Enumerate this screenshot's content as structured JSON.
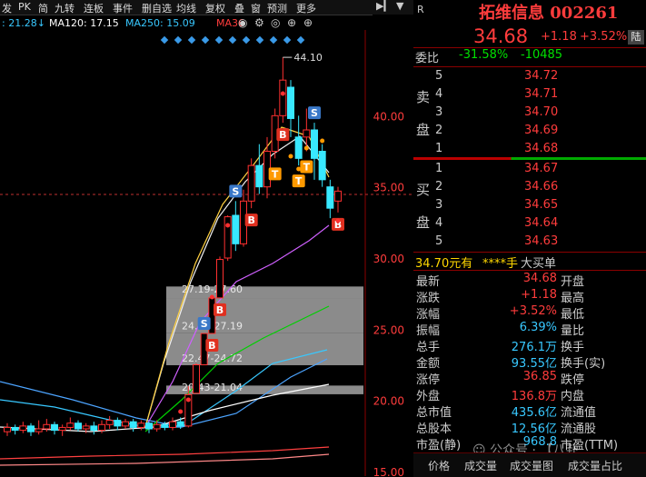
{
  "toolbar": {
    "items": [
      "发",
      "PK",
      "简",
      "九转",
      "连板",
      "事件",
      "删自选",
      "均线",
      "复权",
      "叠",
      "窗",
      "预测",
      "更多"
    ],
    "eye_icon": "eye-icon",
    "lock_icon": "lock-icon",
    "land_label": "陆"
  },
  "ma_legend": [
    {
      "text": ": 21.28↓",
      "color": "#38c8ff"
    },
    {
      "text": "MA120: 17.15",
      "color": "#ffffff"
    },
    {
      "text": "MA250: 15.09",
      "color": "#38c8ff"
    },
    {
      "text": "MA36",
      "color": "#ff3c3c"
    }
  ],
  "chart_data": {
    "type": "candlestick",
    "price_levels": [
      "40.00",
      "35.00",
      "30.00",
      "25.00",
      "20.00",
      "15.00"
    ],
    "ylim": [
      15,
      45
    ],
    "max_label": "44.10",
    "ranges": [
      "27.19-27.60",
      "24.72-27.19",
      "22.47-24.72",
      "20.43-21.04"
    ],
    "candles": [
      {
        "o": 17.8,
        "c": 18.1,
        "h": 18.4,
        "l": 17.5
      },
      {
        "o": 18.1,
        "c": 17.9,
        "h": 18.3,
        "l": 17.6
      },
      {
        "o": 17.9,
        "c": 18.2,
        "h": 18.5,
        "l": 17.7
      },
      {
        "o": 18.2,
        "c": 17.8,
        "h": 18.4,
        "l": 17.5
      },
      {
        "o": 17.8,
        "c": 18.0,
        "h": 18.6,
        "l": 17.6
      },
      {
        "o": 18.0,
        "c": 18.3,
        "h": 18.7,
        "l": 17.8
      },
      {
        "o": 18.3,
        "c": 17.9,
        "h": 18.5,
        "l": 17.6
      },
      {
        "o": 17.9,
        "c": 18.1,
        "h": 18.3,
        "l": 17.5
      },
      {
        "o": 18.1,
        "c": 18.4,
        "h": 18.8,
        "l": 17.9
      },
      {
        "o": 18.4,
        "c": 18.0,
        "h": 18.6,
        "l": 17.8
      },
      {
        "o": 18.0,
        "c": 18.2,
        "h": 18.4,
        "l": 17.7
      },
      {
        "o": 18.2,
        "c": 17.9,
        "h": 18.5,
        "l": 17.6
      },
      {
        "o": 17.9,
        "c": 18.3,
        "h": 18.6,
        "l": 17.7
      },
      {
        "o": 18.3,
        "c": 18.6,
        "h": 18.9,
        "l": 18.0
      },
      {
        "o": 18.6,
        "c": 18.2,
        "h": 18.8,
        "l": 17.9
      },
      {
        "o": 18.2,
        "c": 18.5,
        "h": 18.7,
        "l": 18.0
      },
      {
        "o": 18.5,
        "c": 18.1,
        "h": 18.7,
        "l": 17.8
      },
      {
        "o": 18.1,
        "c": 18.4,
        "h": 18.6,
        "l": 17.9
      },
      {
        "o": 18.4,
        "c": 18.0,
        "h": 18.5,
        "l": 17.7
      },
      {
        "o": 18.0,
        "c": 18.3,
        "h": 18.6,
        "l": 17.8
      },
      {
        "o": 18.3,
        "c": 18.1,
        "h": 18.5,
        "l": 17.9
      },
      {
        "o": 18.1,
        "c": 18.5,
        "h": 18.8,
        "l": 17.9
      },
      {
        "o": 18.5,
        "c": 18.2,
        "h": 18.8,
        "l": 18.0
      },
      {
        "o": 18.2,
        "c": 20.4,
        "h": 21.0,
        "l": 18.1
      },
      {
        "o": 20.5,
        "c": 22.5,
        "h": 22.6,
        "l": 20.5
      },
      {
        "o": 22.5,
        "c": 24.7,
        "h": 24.7,
        "l": 22.5
      },
      {
        "o": 24.7,
        "c": 27.2,
        "h": 27.2,
        "l": 24.7
      },
      {
        "o": 27.2,
        "c": 29.9,
        "h": 30.1,
        "l": 27.2
      },
      {
        "o": 30.0,
        "c": 32.9,
        "h": 33.0,
        "l": 29.8
      },
      {
        "o": 33.0,
        "c": 31.0,
        "h": 34.0,
        "l": 30.5
      },
      {
        "o": 31.0,
        "c": 34.0,
        "h": 34.8,
        "l": 30.8
      },
      {
        "o": 34.0,
        "c": 36.5,
        "h": 37.0,
        "l": 33.5
      },
      {
        "o": 36.5,
        "c": 35.0,
        "h": 38.0,
        "l": 34.5
      },
      {
        "o": 35.0,
        "c": 37.5,
        "h": 38.5,
        "l": 34.2
      },
      {
        "o": 37.5,
        "c": 40.0,
        "h": 40.5,
        "l": 37.0
      },
      {
        "o": 40.0,
        "c": 42.5,
        "h": 44.1,
        "l": 39.5
      },
      {
        "o": 42.0,
        "c": 39.8,
        "h": 42.5,
        "l": 38.5
      },
      {
        "o": 38.5,
        "c": 37.0,
        "h": 40.0,
        "l": 36.5
      },
      {
        "o": 38.5,
        "c": 39.0,
        "h": 40.5,
        "l": 37.5
      },
      {
        "o": 39.0,
        "c": 37.0,
        "h": 39.5,
        "l": 35.5
      },
      {
        "o": 37.5,
        "c": 35.5,
        "h": 38.0,
        "l": 35.0
      },
      {
        "o": 35.0,
        "c": 33.5,
        "h": 35.5,
        "l": 32.8
      },
      {
        "o": 34.0,
        "c": 34.7,
        "h": 35.0,
        "l": 33.2
      }
    ],
    "markers": [
      {
        "i": 25,
        "type": "S",
        "color": "#3a78c8"
      },
      {
        "i": 26,
        "type": "B",
        "color": "#e03020"
      },
      {
        "i": 27,
        "type": "B",
        "color": "#e03020"
      },
      {
        "i": 29,
        "type": "S",
        "color": "#3a78c8"
      },
      {
        "i": 31,
        "type": "B",
        "color": "#e03020"
      },
      {
        "i": 35,
        "type": "B",
        "color": "#e03020"
      },
      {
        "i": 34,
        "type": "T",
        "color": "#ff9a00"
      },
      {
        "i": 37,
        "type": "T",
        "color": "#ff9a00"
      },
      {
        "i": 38,
        "type": "T",
        "color": "#ff9a00"
      },
      {
        "i": 39,
        "type": "S",
        "color": "#3a78c8"
      },
      {
        "i": 42,
        "type": "B",
        "color": "#e03020"
      }
    ]
  },
  "panel": {
    "r_label": "R",
    "name": "拓维信息 002261",
    "price": "34.68",
    "change": "+1.18",
    "change_pct": "+3.52%",
    "land": "陆",
    "weibi_label": "委比",
    "weibi_pct": "-31.58%",
    "weibi_val": "-10485",
    "sell_label": [
      "卖",
      "盘"
    ],
    "buy_label": [
      "买",
      "盘"
    ],
    "sells": [
      {
        "n": "5",
        "p": "34.72"
      },
      {
        "n": "4",
        "p": "34.71"
      },
      {
        "n": "3",
        "p": "34.70"
      },
      {
        "n": "2",
        "p": "34.69"
      },
      {
        "n": "1",
        "p": "34.68"
      }
    ],
    "buys": [
      {
        "n": "1",
        "p": "34.67"
      },
      {
        "n": "2",
        "p": "34.66"
      },
      {
        "n": "3",
        "p": "34.65"
      },
      {
        "n": "4",
        "p": "34.64"
      },
      {
        "n": "5",
        "p": "34.63"
      }
    ],
    "big_buy": {
      "price": "34.70元有",
      "qty": "****手",
      "label": "大买单"
    },
    "stats": [
      {
        "l": "最新",
        "v": "34.68",
        "c": "red",
        "r": "开盘"
      },
      {
        "l": "涨跌",
        "v": "+1.18",
        "c": "red",
        "r": "最高"
      },
      {
        "l": "涨幅",
        "v": "+3.52%",
        "c": "red",
        "r": "最低"
      },
      {
        "l": "振幅",
        "v": "6.39%",
        "c": "cyan",
        "r": "量比"
      },
      {
        "l": "总手",
        "v": "276.1万",
        "c": "cyan",
        "r": "换手"
      },
      {
        "l": "金额",
        "v": "93.55亿",
        "c": "cyan",
        "r": "换手(实)"
      },
      {
        "l": "涨停",
        "v": "36.85",
        "c": "red",
        "r": "跌停"
      },
      {
        "l": "外盘",
        "v": "136.8万",
        "c": "red",
        "r": "内盘"
      },
      {
        "l": "总市值",
        "v": "435.6亿",
        "c": "cyan",
        "r": "流通值"
      },
      {
        "l": "总股本",
        "v": "12.56亿",
        "c": "cyan",
        "r": "流通股"
      },
      {
        "l": "市盈(静)",
        "v": "968.8",
        "c": "cyan",
        "r": "市盈(TTM)"
      }
    ]
  },
  "bottom_tabs": [
    "价格",
    "成交量",
    "成交量图",
    "成交量占比"
  ],
  "watermark": "公众号 · 【八卦"
}
